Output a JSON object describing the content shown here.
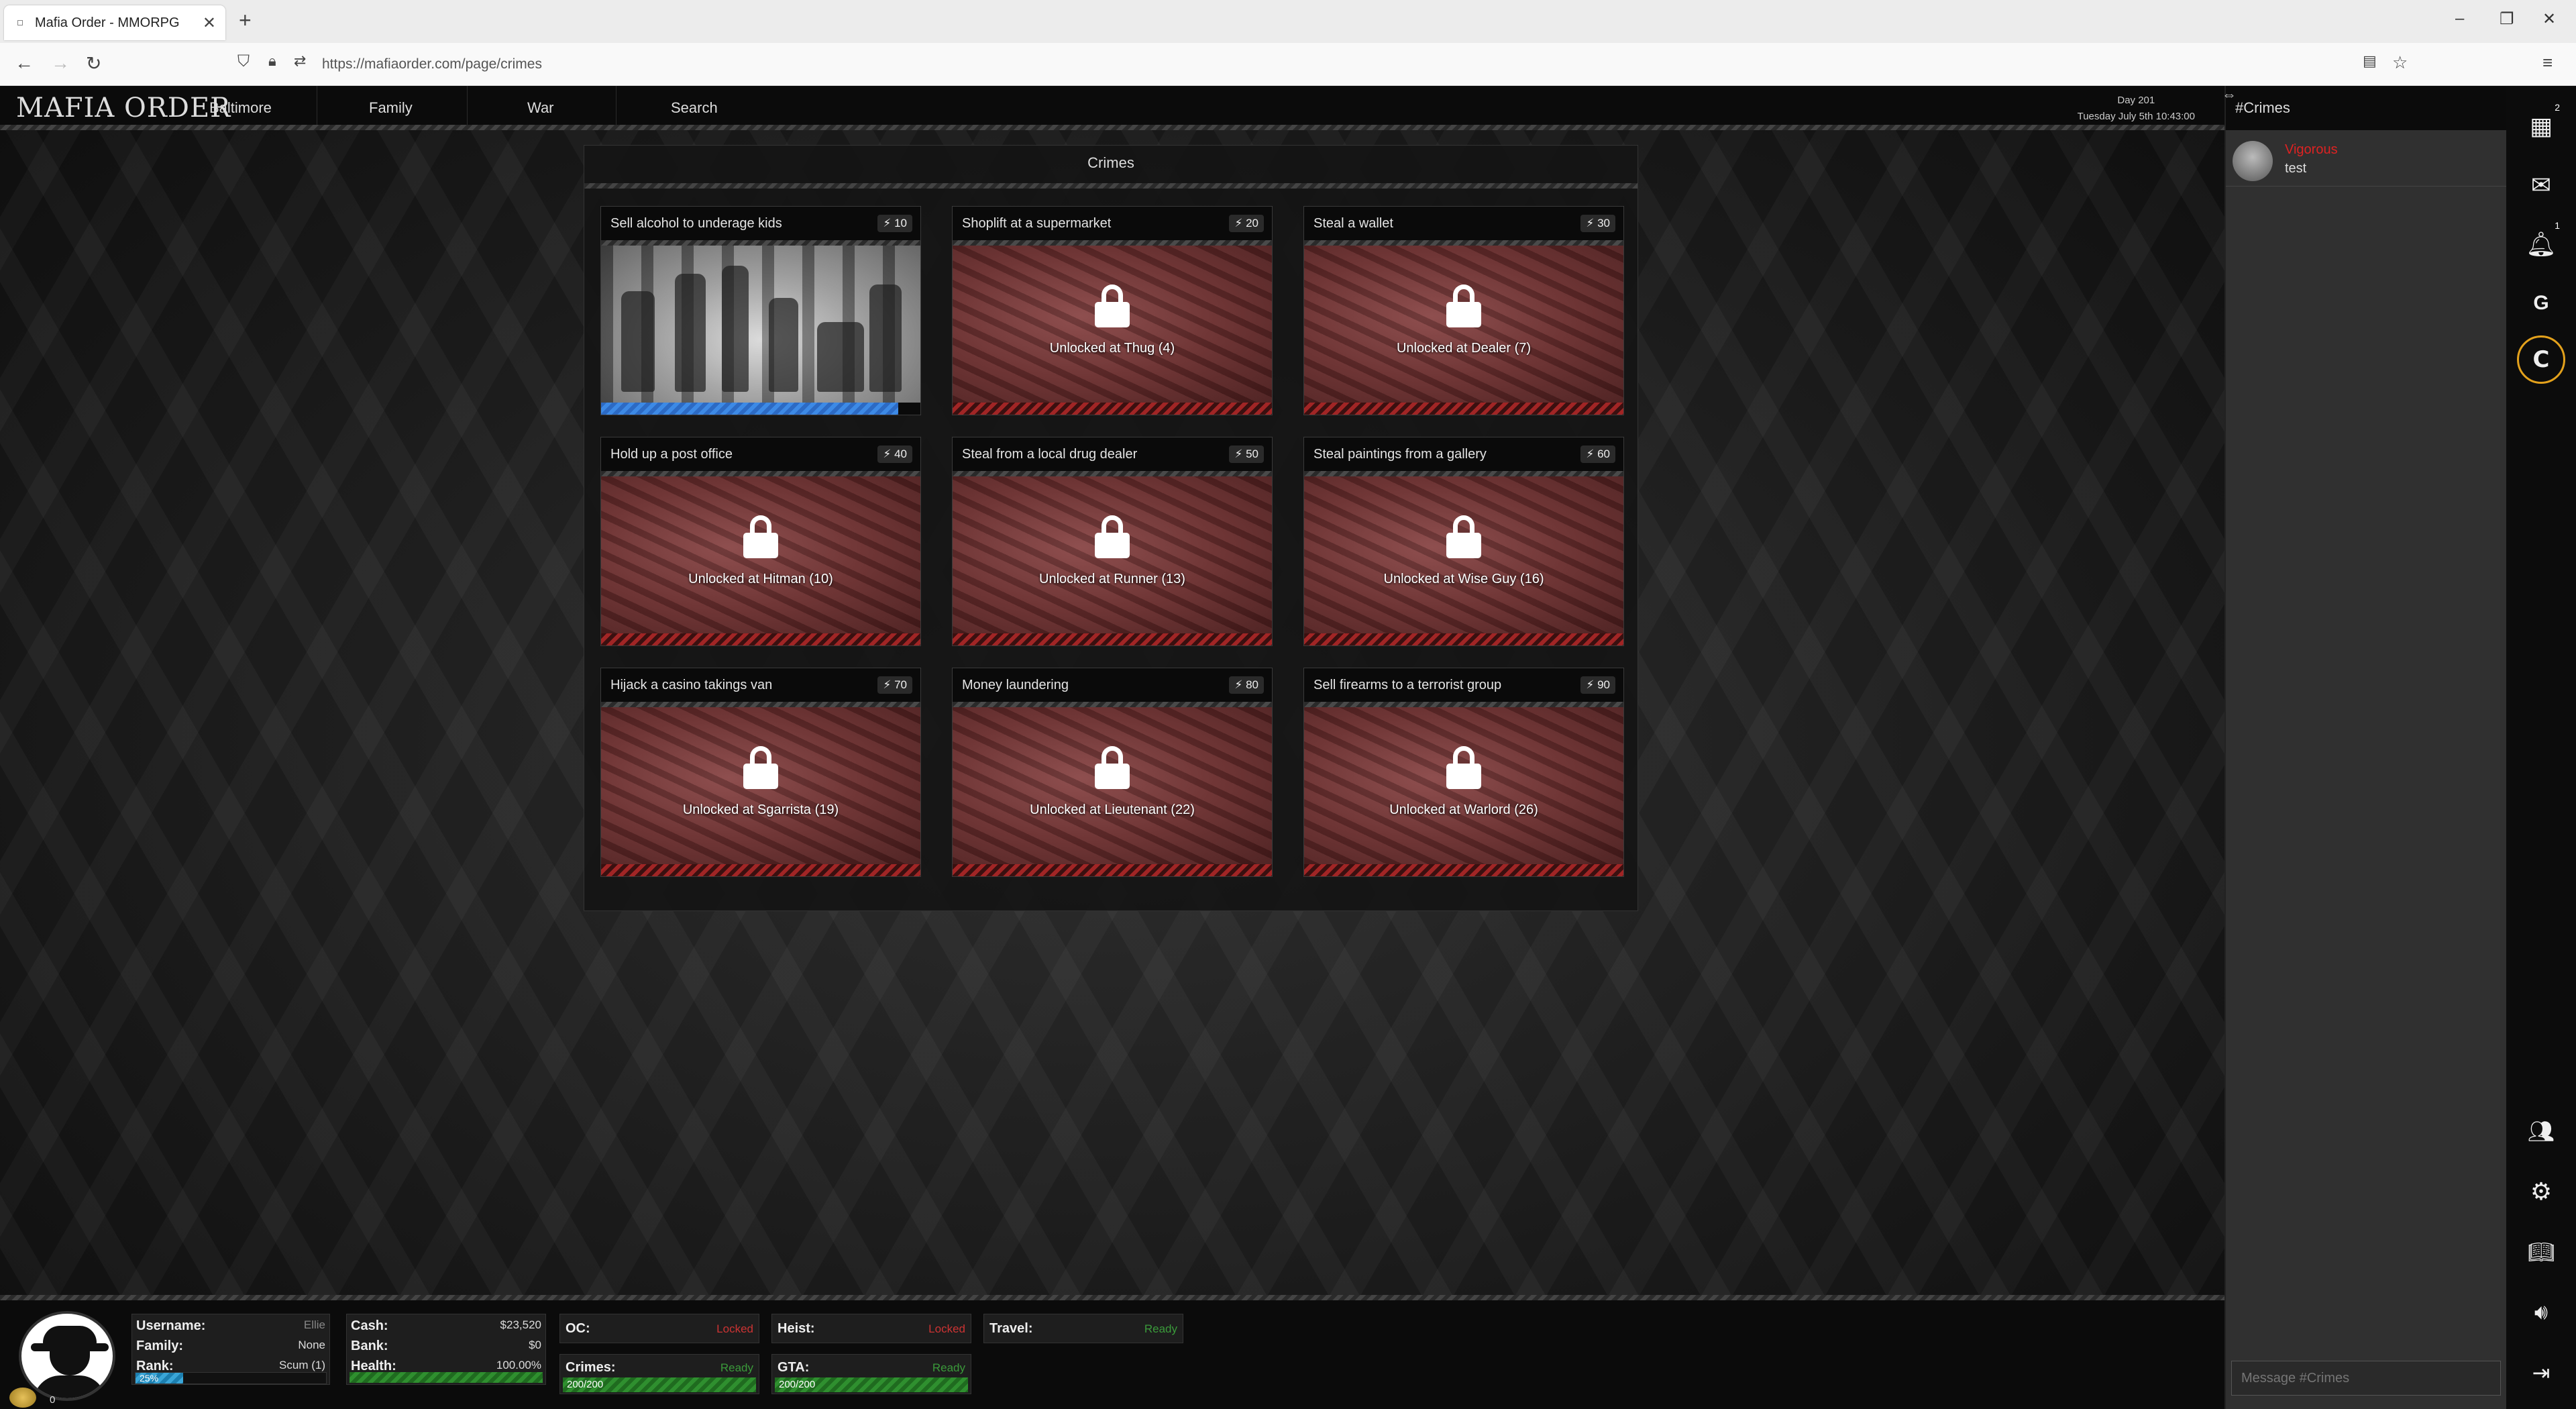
{
  "browser": {
    "tab_title": "Mafia Order - MMORPG",
    "url": "https://mafiaorder.com/page/crimes"
  },
  "site": {
    "logo": "MAFIA ORDER",
    "nav": [
      "Baltimore",
      "Family",
      "War",
      "Search"
    ],
    "day": "Day 201",
    "datetime": "Tuesday July 5th 10:43:00"
  },
  "crimes": {
    "title": "Crimes",
    "items": [
      {
        "name": "Sell alcohol to underage kids",
        "cost": "10",
        "locked": false,
        "progress": 0.93
      },
      {
        "name": "Shoplift at a supermarket",
        "cost": "20",
        "locked": true,
        "unlock": "Unlocked at Thug (4)"
      },
      {
        "name": "Steal a wallet",
        "cost": "30",
        "locked": true,
        "unlock": "Unlocked at Dealer (7)"
      },
      {
        "name": "Hold up a post office",
        "cost": "40",
        "locked": true,
        "unlock": "Unlocked at Hitman (10)"
      },
      {
        "name": "Steal from a local drug dealer",
        "cost": "50",
        "locked": true,
        "unlock": "Unlocked at Runner (13)"
      },
      {
        "name": "Steal paintings from a gallery",
        "cost": "60",
        "locked": true,
        "unlock": "Unlocked at Wise Guy (16)"
      },
      {
        "name": "Hijack a casino takings van",
        "cost": "70",
        "locked": true,
        "unlock": "Unlocked at Sgarrista (19)"
      },
      {
        "name": "Money laundering",
        "cost": "80",
        "locked": true,
        "unlock": "Unlocked at Lieutenant (22)"
      },
      {
        "name": "Sell firearms to a terrorist group",
        "cost": "90",
        "locked": true,
        "unlock": "Unlocked at Warlord (26)"
      }
    ]
  },
  "chat": {
    "channel": "#Crimes",
    "messages": [
      {
        "user": "Vigorous",
        "text": "test"
      }
    ],
    "input_placeholder": "Message #Crimes"
  },
  "sidebar_badges": {
    "map": "2",
    "notifications": "1"
  },
  "player": {
    "coins": "0",
    "username_label": "Username:",
    "username": "Ellie",
    "family_label": "Family:",
    "family": "None",
    "rank_label": "Rank:",
    "rank": "Scum (1)",
    "rank_progress": "25%",
    "cash_label": "Cash:",
    "cash": "$23,520",
    "bank_label": "Bank:",
    "bank": "$0",
    "health_label": "Health:",
    "health": "100.00%",
    "oc_label": "OC:",
    "oc": "Locked",
    "heist_label": "Heist:",
    "heist": "Locked",
    "travel_label": "Travel:",
    "travel": "Ready",
    "crimes_label": "Crimes:",
    "crimes": "Ready",
    "crimes_value": "200/200",
    "gta_label": "GTA:",
    "gta": "Ready",
    "gta_value": "200/200"
  },
  "colors": {
    "accent_ring": "#e3a11c",
    "ready": "#3a9a3a",
    "locked": "#cc3333",
    "chat_user": "#dd2222"
  }
}
